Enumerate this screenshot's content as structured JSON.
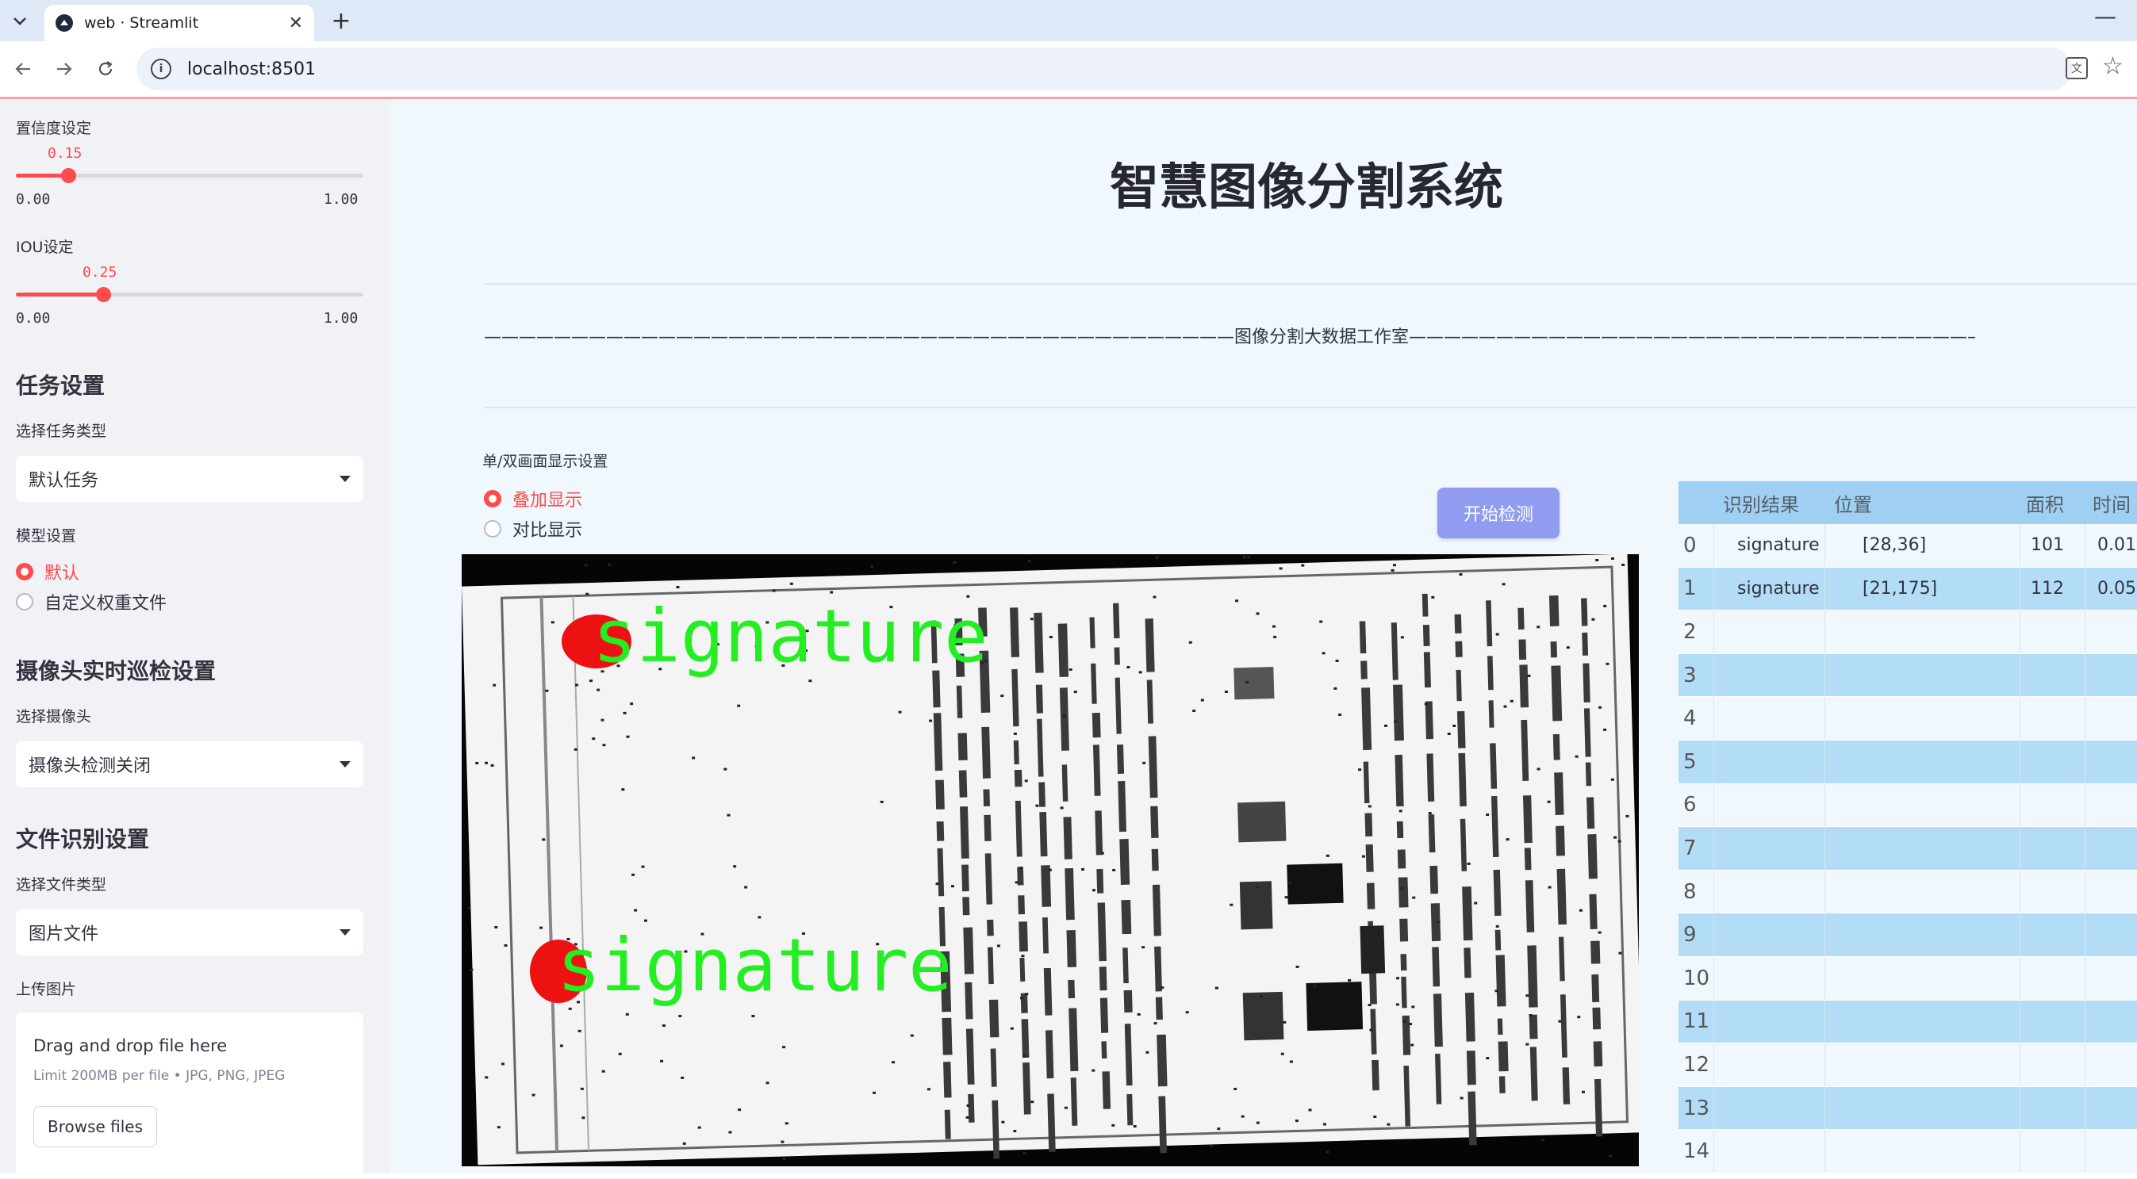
{
  "browser": {
    "tab_title": "web · Streamlit",
    "url": "localhost:8501"
  },
  "sidebar": {
    "confidence": {
      "label": "置信度设定",
      "value": "0.15",
      "value_num": 0.15,
      "min": "0.00",
      "max": "1.00"
    },
    "iou": {
      "label": "IOU设定",
      "value": "0.25",
      "value_num": 0.25,
      "min": "0.00",
      "max": "1.00"
    },
    "task_section": {
      "heading": "任务设置",
      "select_label": "选择任务类型",
      "selected": "默认任务"
    },
    "model_section": {
      "label": "模型设置",
      "options": [
        "默认",
        "自定义权重文件"
      ],
      "selected_index": 0
    },
    "camera_section": {
      "heading": "摄像头实时巡检设置",
      "select_label": "选择摄像头",
      "selected": "摄像头检测关闭"
    },
    "file_section": {
      "heading": "文件识别设置",
      "select_label": "选择文件类型",
      "selected": "图片文件"
    },
    "upload": {
      "label": "上传图片",
      "title": "Drag and drop file here",
      "limit": "Limit 200MB per file • JPG, PNG, JPEG",
      "browse_label": "Browse files"
    }
  },
  "main": {
    "title": "智慧图像分割系统",
    "studio": "———————————————————————————————————————————图像分割大数据工作室———————————————————————————————————————————",
    "display_label": "单/双画面显示设置",
    "display_options": [
      "叠加显示",
      "对比显示"
    ],
    "display_selected_index": 0,
    "start_button": "开始检测",
    "detections": [
      "signature",
      "signature"
    ]
  },
  "table": {
    "headers": [
      "识别结果",
      "位置",
      "面积",
      "时间"
    ],
    "rows": [
      {
        "index": "0",
        "result": "signature",
        "position": "[28,36]",
        "area": "101",
        "time": "0.01"
      },
      {
        "index": "1",
        "result": "signature",
        "position": "[21,175]",
        "area": "112",
        "time": "0.05"
      },
      {
        "index": "2",
        "result": "",
        "position": "",
        "area": "",
        "time": ""
      },
      {
        "index": "3",
        "result": "",
        "position": "",
        "area": "",
        "time": ""
      },
      {
        "index": "4",
        "result": "",
        "position": "",
        "area": "",
        "time": ""
      },
      {
        "index": "5",
        "result": "",
        "position": "",
        "area": "",
        "time": ""
      },
      {
        "index": "6",
        "result": "",
        "position": "",
        "area": "",
        "time": ""
      },
      {
        "index": "7",
        "result": "",
        "position": "",
        "area": "",
        "time": ""
      },
      {
        "index": "8",
        "result": "",
        "position": "",
        "area": "",
        "time": ""
      },
      {
        "index": "9",
        "result": "",
        "position": "",
        "area": "",
        "time": ""
      },
      {
        "index": "10",
        "result": "",
        "position": "",
        "area": "",
        "time": ""
      },
      {
        "index": "11",
        "result": "",
        "position": "",
        "area": "",
        "time": ""
      },
      {
        "index": "12",
        "result": "",
        "position": "",
        "area": "",
        "time": ""
      },
      {
        "index": "13",
        "result": "",
        "position": "",
        "area": "",
        "time": ""
      },
      {
        "index": "14",
        "result": "",
        "position": "",
        "area": "",
        "time": ""
      }
    ]
  },
  "colors": {
    "accent": "#ff4b4b",
    "detection_label": "#22ee22",
    "detection_mask": "#ee1111",
    "table_stripe": "#b3ddf7",
    "button": "#8f9cf0"
  }
}
